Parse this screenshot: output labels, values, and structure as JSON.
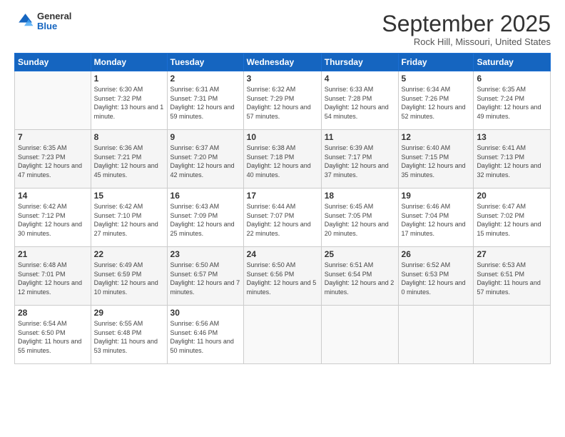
{
  "logo": {
    "general": "General",
    "blue": "Blue"
  },
  "title": "September 2025",
  "location": "Rock Hill, Missouri, United States",
  "days_header": [
    "Sunday",
    "Monday",
    "Tuesday",
    "Wednesday",
    "Thursday",
    "Friday",
    "Saturday"
  ],
  "weeks": [
    [
      {
        "day": "",
        "sunrise": "",
        "sunset": "",
        "daylight": ""
      },
      {
        "day": "1",
        "sunrise": "Sunrise: 6:30 AM",
        "sunset": "Sunset: 7:32 PM",
        "daylight": "Daylight: 13 hours and 1 minute."
      },
      {
        "day": "2",
        "sunrise": "Sunrise: 6:31 AM",
        "sunset": "Sunset: 7:31 PM",
        "daylight": "Daylight: 12 hours and 59 minutes."
      },
      {
        "day": "3",
        "sunrise": "Sunrise: 6:32 AM",
        "sunset": "Sunset: 7:29 PM",
        "daylight": "Daylight: 12 hours and 57 minutes."
      },
      {
        "day": "4",
        "sunrise": "Sunrise: 6:33 AM",
        "sunset": "Sunset: 7:28 PM",
        "daylight": "Daylight: 12 hours and 54 minutes."
      },
      {
        "day": "5",
        "sunrise": "Sunrise: 6:34 AM",
        "sunset": "Sunset: 7:26 PM",
        "daylight": "Daylight: 12 hours and 52 minutes."
      },
      {
        "day": "6",
        "sunrise": "Sunrise: 6:35 AM",
        "sunset": "Sunset: 7:24 PM",
        "daylight": "Daylight: 12 hours and 49 minutes."
      }
    ],
    [
      {
        "day": "7",
        "sunrise": "Sunrise: 6:35 AM",
        "sunset": "Sunset: 7:23 PM",
        "daylight": "Daylight: 12 hours and 47 minutes."
      },
      {
        "day": "8",
        "sunrise": "Sunrise: 6:36 AM",
        "sunset": "Sunset: 7:21 PM",
        "daylight": "Daylight: 12 hours and 45 minutes."
      },
      {
        "day": "9",
        "sunrise": "Sunrise: 6:37 AM",
        "sunset": "Sunset: 7:20 PM",
        "daylight": "Daylight: 12 hours and 42 minutes."
      },
      {
        "day": "10",
        "sunrise": "Sunrise: 6:38 AM",
        "sunset": "Sunset: 7:18 PM",
        "daylight": "Daylight: 12 hours and 40 minutes."
      },
      {
        "day": "11",
        "sunrise": "Sunrise: 6:39 AM",
        "sunset": "Sunset: 7:17 PM",
        "daylight": "Daylight: 12 hours and 37 minutes."
      },
      {
        "day": "12",
        "sunrise": "Sunrise: 6:40 AM",
        "sunset": "Sunset: 7:15 PM",
        "daylight": "Daylight: 12 hours and 35 minutes."
      },
      {
        "day": "13",
        "sunrise": "Sunrise: 6:41 AM",
        "sunset": "Sunset: 7:13 PM",
        "daylight": "Daylight: 12 hours and 32 minutes."
      }
    ],
    [
      {
        "day": "14",
        "sunrise": "Sunrise: 6:42 AM",
        "sunset": "Sunset: 7:12 PM",
        "daylight": "Daylight: 12 hours and 30 minutes."
      },
      {
        "day": "15",
        "sunrise": "Sunrise: 6:42 AM",
        "sunset": "Sunset: 7:10 PM",
        "daylight": "Daylight: 12 hours and 27 minutes."
      },
      {
        "day": "16",
        "sunrise": "Sunrise: 6:43 AM",
        "sunset": "Sunset: 7:09 PM",
        "daylight": "Daylight: 12 hours and 25 minutes."
      },
      {
        "day": "17",
        "sunrise": "Sunrise: 6:44 AM",
        "sunset": "Sunset: 7:07 PM",
        "daylight": "Daylight: 12 hours and 22 minutes."
      },
      {
        "day": "18",
        "sunrise": "Sunrise: 6:45 AM",
        "sunset": "Sunset: 7:05 PM",
        "daylight": "Daylight: 12 hours and 20 minutes."
      },
      {
        "day": "19",
        "sunrise": "Sunrise: 6:46 AM",
        "sunset": "Sunset: 7:04 PM",
        "daylight": "Daylight: 12 hours and 17 minutes."
      },
      {
        "day": "20",
        "sunrise": "Sunrise: 6:47 AM",
        "sunset": "Sunset: 7:02 PM",
        "daylight": "Daylight: 12 hours and 15 minutes."
      }
    ],
    [
      {
        "day": "21",
        "sunrise": "Sunrise: 6:48 AM",
        "sunset": "Sunset: 7:01 PM",
        "daylight": "Daylight: 12 hours and 12 minutes."
      },
      {
        "day": "22",
        "sunrise": "Sunrise: 6:49 AM",
        "sunset": "Sunset: 6:59 PM",
        "daylight": "Daylight: 12 hours and 10 minutes."
      },
      {
        "day": "23",
        "sunrise": "Sunrise: 6:50 AM",
        "sunset": "Sunset: 6:57 PM",
        "daylight": "Daylight: 12 hours and 7 minutes."
      },
      {
        "day": "24",
        "sunrise": "Sunrise: 6:50 AM",
        "sunset": "Sunset: 6:56 PM",
        "daylight": "Daylight: 12 hours and 5 minutes."
      },
      {
        "day": "25",
        "sunrise": "Sunrise: 6:51 AM",
        "sunset": "Sunset: 6:54 PM",
        "daylight": "Daylight: 12 hours and 2 minutes."
      },
      {
        "day": "26",
        "sunrise": "Sunrise: 6:52 AM",
        "sunset": "Sunset: 6:53 PM",
        "daylight": "Daylight: 12 hours and 0 minutes."
      },
      {
        "day": "27",
        "sunrise": "Sunrise: 6:53 AM",
        "sunset": "Sunset: 6:51 PM",
        "daylight": "Daylight: 11 hours and 57 minutes."
      }
    ],
    [
      {
        "day": "28",
        "sunrise": "Sunrise: 6:54 AM",
        "sunset": "Sunset: 6:50 PM",
        "daylight": "Daylight: 11 hours and 55 minutes."
      },
      {
        "day": "29",
        "sunrise": "Sunrise: 6:55 AM",
        "sunset": "Sunset: 6:48 PM",
        "daylight": "Daylight: 11 hours and 53 minutes."
      },
      {
        "day": "30",
        "sunrise": "Sunrise: 6:56 AM",
        "sunset": "Sunset: 6:46 PM",
        "daylight": "Daylight: 11 hours and 50 minutes."
      },
      {
        "day": "",
        "sunrise": "",
        "sunset": "",
        "daylight": ""
      },
      {
        "day": "",
        "sunrise": "",
        "sunset": "",
        "daylight": ""
      },
      {
        "day": "",
        "sunrise": "",
        "sunset": "",
        "daylight": ""
      },
      {
        "day": "",
        "sunrise": "",
        "sunset": "",
        "daylight": ""
      }
    ]
  ]
}
